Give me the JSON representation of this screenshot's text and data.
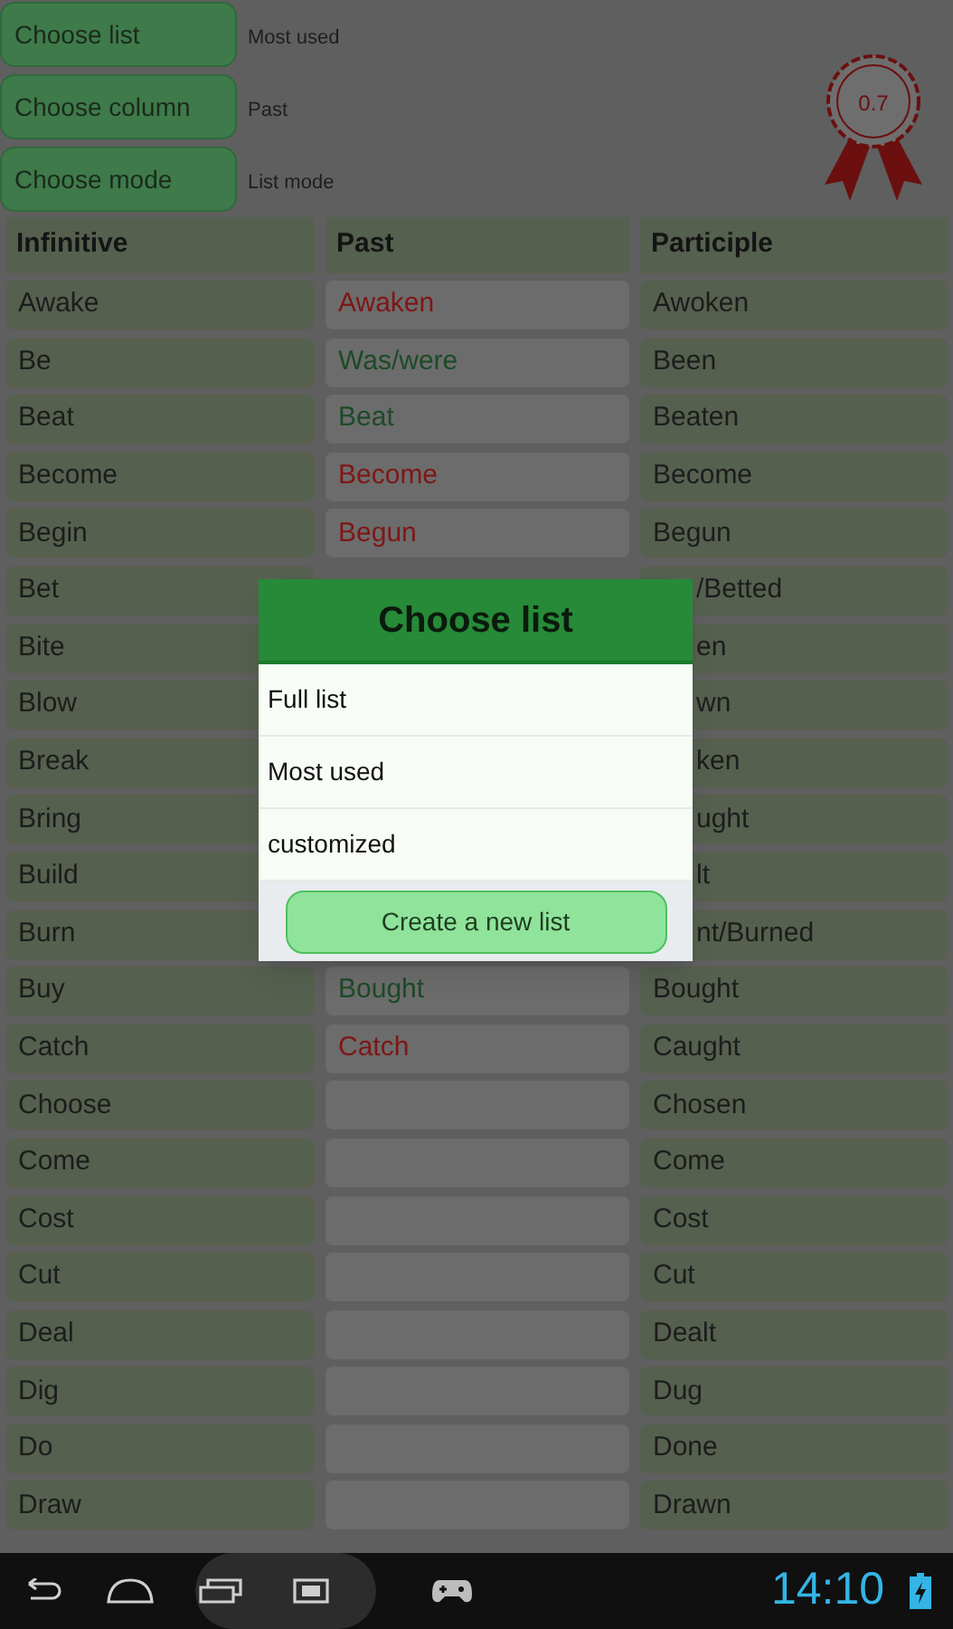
{
  "controls": [
    {
      "label": "Choose list",
      "value": "Most used"
    },
    {
      "label": "Choose column",
      "value": "Past"
    },
    {
      "label": "Choose mode",
      "value": "List mode"
    }
  ],
  "score_badge": {
    "value": "0.7"
  },
  "table": {
    "columns": [
      "Infinitive",
      "Past",
      "Participle"
    ],
    "rows": [
      {
        "infinitive": "Awake",
        "past": "Awaken",
        "correct": false,
        "participle": "Awoken"
      },
      {
        "infinitive": "Be",
        "past": "Was/were",
        "correct": true,
        "participle": "Been"
      },
      {
        "infinitive": "Beat",
        "past": "Beat",
        "correct": true,
        "participle": "Beaten"
      },
      {
        "infinitive": "Become",
        "past": "Become",
        "correct": false,
        "participle": "Become"
      },
      {
        "infinitive": "Begin",
        "past": "Begun",
        "correct": false,
        "participle": "Begun"
      },
      {
        "infinitive": "Bet",
        "covered": true,
        "participle": "/Betted"
      },
      {
        "infinitive": "Bite",
        "covered": true,
        "participle": "en"
      },
      {
        "infinitive": "Blow",
        "covered": true,
        "participle": "wn"
      },
      {
        "infinitive": "Break",
        "covered": true,
        "participle": "ken"
      },
      {
        "infinitive": "Bring",
        "covered": true,
        "participle": "ught"
      },
      {
        "infinitive": "Build",
        "covered": true,
        "participle": "lt"
      },
      {
        "infinitive": "Burn",
        "covered": true,
        "participle": "nt/Burned"
      },
      {
        "infinitive": "Buy",
        "past": "Bought",
        "correct": true,
        "participle": "Bought"
      },
      {
        "infinitive": "Catch",
        "past": "Catch",
        "correct": false,
        "participle": "Caught"
      },
      {
        "infinitive": "Choose",
        "participle": "Chosen"
      },
      {
        "infinitive": "Come",
        "participle": "Come"
      },
      {
        "infinitive": "Cost",
        "participle": "Cost"
      },
      {
        "infinitive": "Cut",
        "participle": "Cut"
      },
      {
        "infinitive": "Deal",
        "participle": "Dealt"
      },
      {
        "infinitive": "Dig",
        "participle": "Dug"
      },
      {
        "infinitive": "Do",
        "participle": "Done"
      },
      {
        "infinitive": "Draw",
        "participle": "Drawn"
      }
    ]
  },
  "dialog": {
    "title": "Choose list",
    "items": [
      "Full list",
      "Most used",
      "customized"
    ],
    "button": "Create a new list"
  },
  "status_bar": {
    "time": "14:10"
  }
}
